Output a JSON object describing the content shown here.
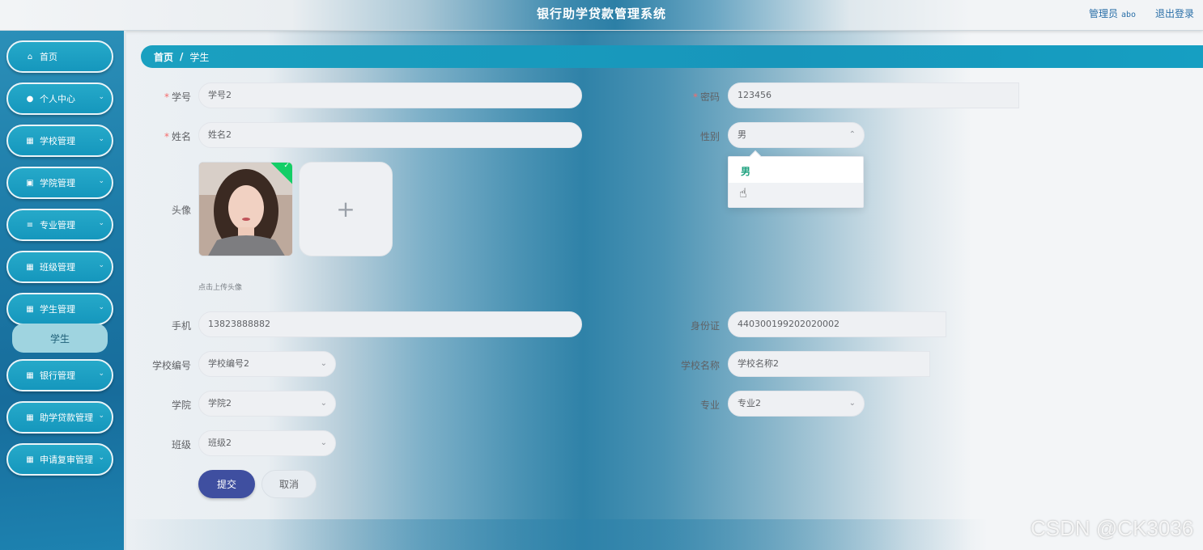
{
  "header": {
    "app_title": "银行助学贷款管理系统",
    "user_role": "管理员",
    "user_name": "abo",
    "logout": "退出登录"
  },
  "sidebar": {
    "items": [
      {
        "label": "首页",
        "icon": "home-icon"
      },
      {
        "label": "个人中心",
        "icon": "user-icon"
      },
      {
        "label": "学校管理",
        "icon": "grid-icon"
      },
      {
        "label": "学院管理",
        "icon": "building-icon"
      },
      {
        "label": "专业管理",
        "icon": "sliders-icon"
      },
      {
        "label": "班级管理",
        "icon": "grid-icon"
      },
      {
        "label": "学生管理",
        "icon": "grid-icon"
      },
      {
        "label": "银行管理",
        "icon": "grid-icon"
      },
      {
        "label": "助学贷款管理",
        "icon": "grid-icon"
      },
      {
        "label": "申请复审管理",
        "icon": "grid-icon"
      }
    ],
    "active_sub": "学生"
  },
  "breadcrumb": {
    "home": "首页",
    "separator": "/",
    "current": "学生"
  },
  "form": {
    "student_no": {
      "label": "学号",
      "value": "学号2"
    },
    "password": {
      "label": "密码",
      "value": "123456"
    },
    "name": {
      "label": "姓名",
      "value": "姓名2"
    },
    "gender": {
      "label": "性别",
      "value": "男",
      "options": [
        "男"
      ]
    },
    "avatar": {
      "label": "头像",
      "tip": "点击上传头像"
    },
    "phone": {
      "label": "手机",
      "value": "13823888882"
    },
    "id_card": {
      "label": "身份证",
      "value": "440300199202020002"
    },
    "school_no": {
      "label": "学校编号",
      "value": "学校编号2"
    },
    "school_name": {
      "label": "学校名称",
      "value": "学校名称2"
    },
    "college": {
      "label": "学院",
      "value": "学院2"
    },
    "major": {
      "label": "专业",
      "value": "专业2"
    },
    "class": {
      "label": "班级",
      "value": "班级2"
    }
  },
  "buttons": {
    "submit": "提交",
    "cancel": "取消"
  },
  "watermark": "CSDN @CK3036",
  "colors": {
    "accent": "#1597bd",
    "submit": "#3f4fa0",
    "selected_option": "#1ea17f",
    "required": "#f56c6c"
  }
}
